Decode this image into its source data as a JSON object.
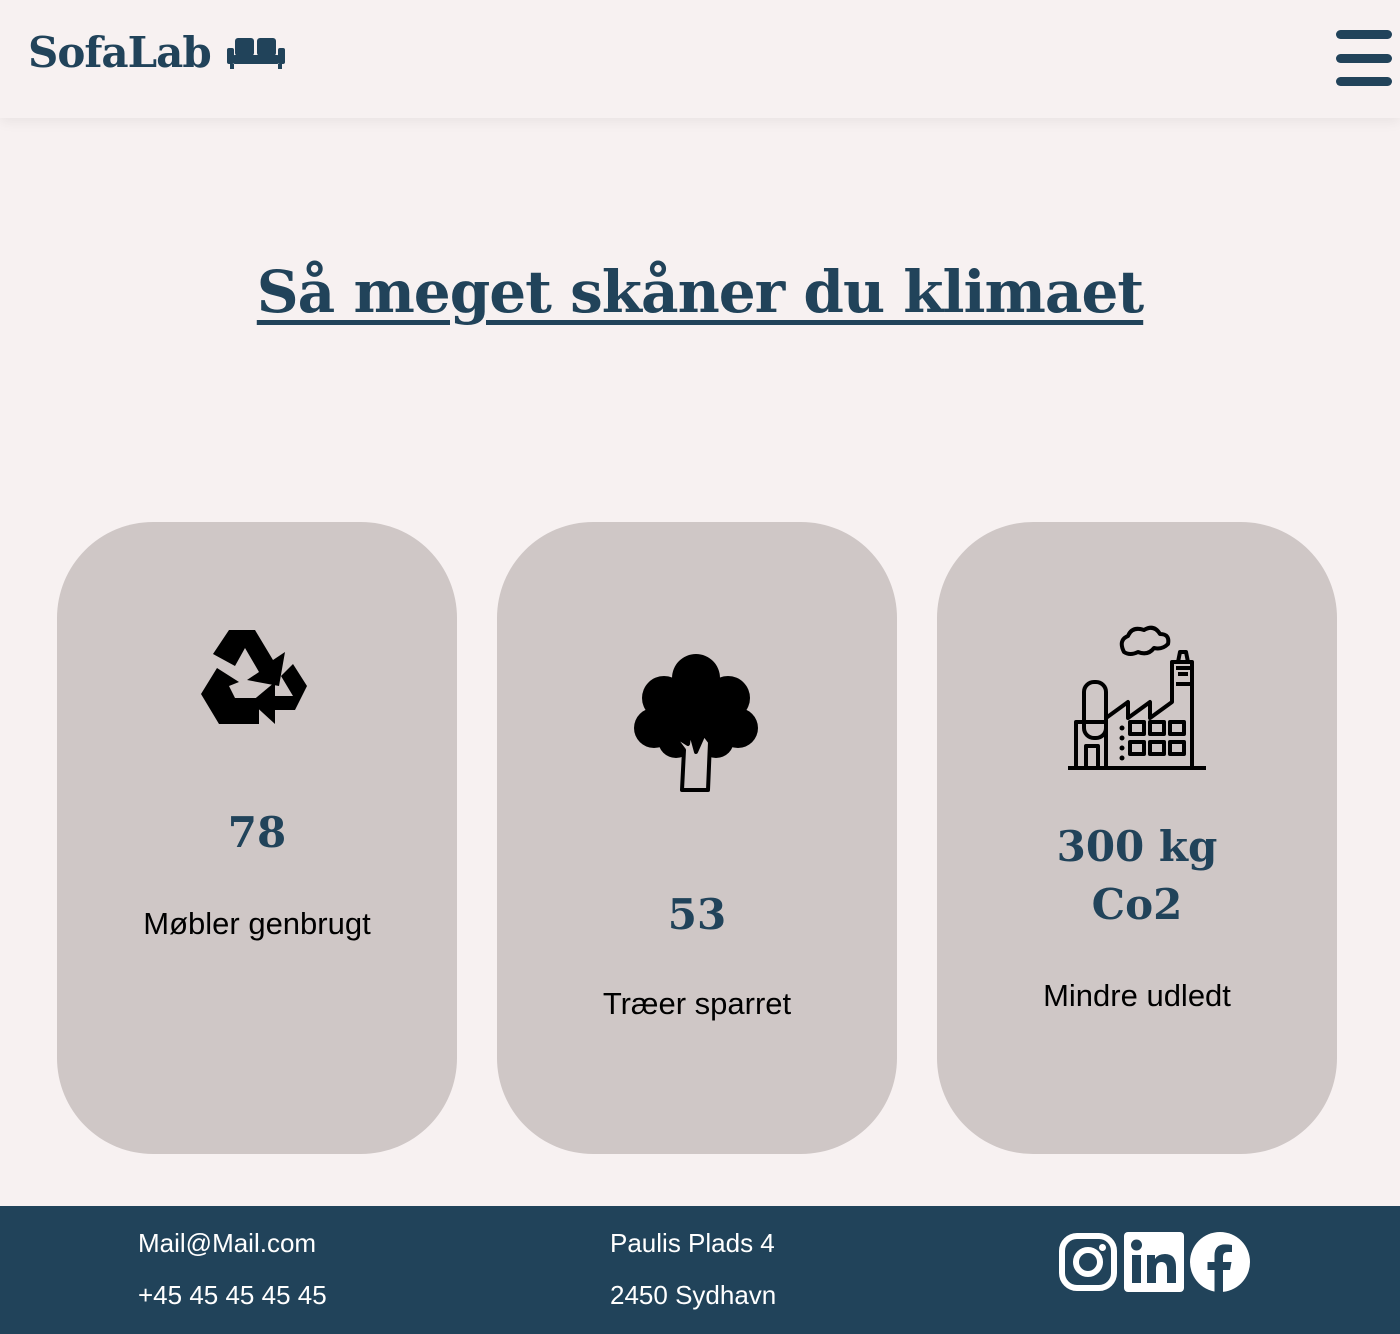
{
  "header": {
    "brand": "SofaLab",
    "brand_icon": "sofa-icon",
    "menu_icon": "hamburger-menu-icon"
  },
  "main": {
    "headline": "Så meget skåner du klimaet",
    "cards": [
      {
        "icon": "recycle-icon",
        "value": "78",
        "caption": "Møbler genbrugt"
      },
      {
        "icon": "tree-icon",
        "value": "53",
        "caption": "Træer sparret"
      },
      {
        "icon": "factory-icon",
        "value": "300 kg Co2",
        "caption": "Mindre udledt"
      }
    ]
  },
  "footer": {
    "email": "Mail@Mail.com",
    "phone": "+45 45 45 45 45",
    "street": "Paulis Plads 4",
    "city": "2450 Sydhavn",
    "social": [
      "instagram-icon",
      "linkedin-icon",
      "facebook-icon"
    ]
  },
  "colors": {
    "primary": "#21435a",
    "background": "#f7f1f1",
    "card": "#cfc7c6",
    "footer_text": "#ffffff"
  }
}
